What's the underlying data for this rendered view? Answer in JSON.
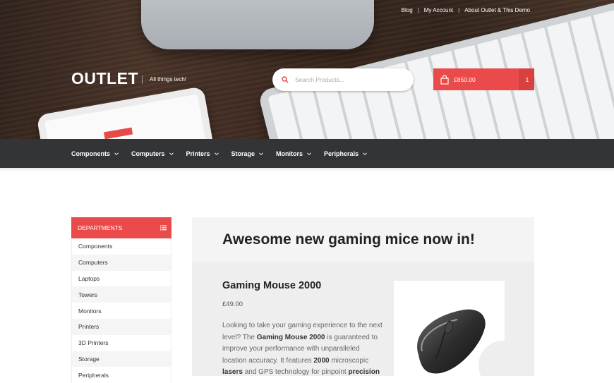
{
  "header": {
    "top_links": [
      "Blog",
      "My Account",
      "About Outlet & This Demo"
    ],
    "logo": "OUTLET",
    "tagline": "All things tech!",
    "search": {
      "placeholder": "Search Products..."
    },
    "cart": {
      "total": "£850.00",
      "count": "1"
    }
  },
  "nav": {
    "items": [
      "Components",
      "Computers",
      "Printers",
      "Storage",
      "Monitors",
      "Peripherals"
    ]
  },
  "sidebar": {
    "title": "DEPARTMENTS",
    "items": [
      "Components",
      "Computers",
      "Laptops",
      "Towers",
      "Monitors",
      "Printers",
      "3D Printers",
      "Storage",
      "Peripherals"
    ]
  },
  "main": {
    "heading": "Awesome new gaming mice now in!",
    "product": {
      "name": "Gaming Mouse 2000",
      "price": "£49.00",
      "desc_1": "Looking to take your gaming experience to the next level? The ",
      "desc_b1": "Gaming Mouse 2000",
      "desc_2": " is guaranteed to improve your performance with unparalleled location accuracy. It features ",
      "desc_b2": "2000",
      "desc_3": " microscopic ",
      "desc_b3": "lasers",
      "desc_4": " and GPS technology for pinpoint ",
      "desc_b4": "precision"
    }
  },
  "colors": {
    "accent": "#ea4b4a",
    "nav_bg": "#333436"
  }
}
